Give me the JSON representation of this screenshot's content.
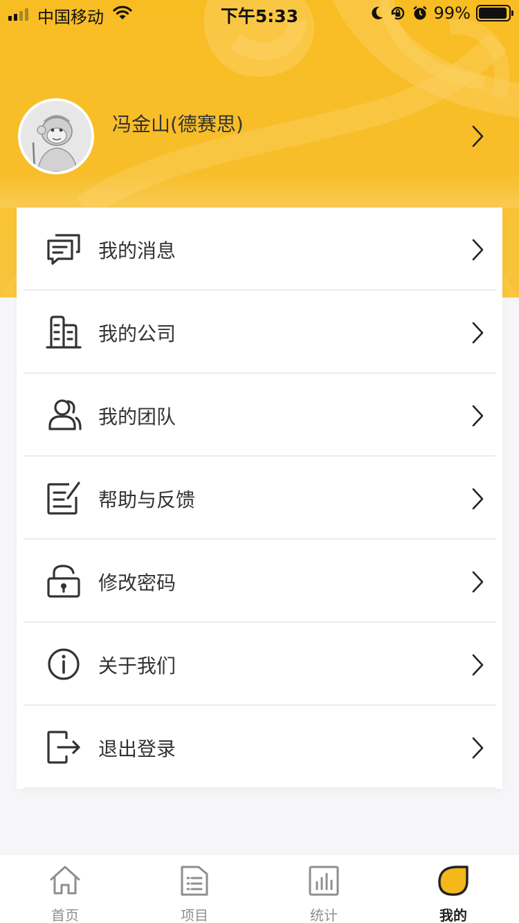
{
  "status_bar": {
    "carrier": "中国移动",
    "time": "下午5:33",
    "battery": "99%",
    "battery_level": 0.99,
    "icons": [
      "signal-icon",
      "wifi-icon",
      "moon-icon",
      "rotation-lock-icon",
      "alarm-icon",
      "battery-icon"
    ]
  },
  "profile": {
    "name": "冯金山(德赛思)",
    "avatar_icon": "monkey-avatar"
  },
  "menu": {
    "items": [
      {
        "label": "我的消息",
        "icon": "message-icon"
      },
      {
        "label": "我的公司",
        "icon": "building-icon"
      },
      {
        "label": "我的团队",
        "icon": "team-icon"
      },
      {
        "label": "帮助与反馈",
        "icon": "feedback-icon"
      },
      {
        "label": "修改密码",
        "icon": "lock-icon"
      },
      {
        "label": "关于我们",
        "icon": "info-icon"
      },
      {
        "label": "退出登录",
        "icon": "logout-icon"
      }
    ]
  },
  "tabbar": {
    "tabs": [
      {
        "label": "首页",
        "icon": "home-icon",
        "active": false
      },
      {
        "label": "项目",
        "icon": "folder-list-icon",
        "active": false
      },
      {
        "label": "统计",
        "icon": "chart-icon",
        "active": false
      },
      {
        "label": "我的",
        "icon": "profile-drop-icon",
        "active": true
      }
    ]
  },
  "colors": {
    "accent": "#f9bd24",
    "active_tab_fill": "#f4b81a",
    "text_primary": "#333333",
    "tab_inactive": "#8e8e8e"
  }
}
